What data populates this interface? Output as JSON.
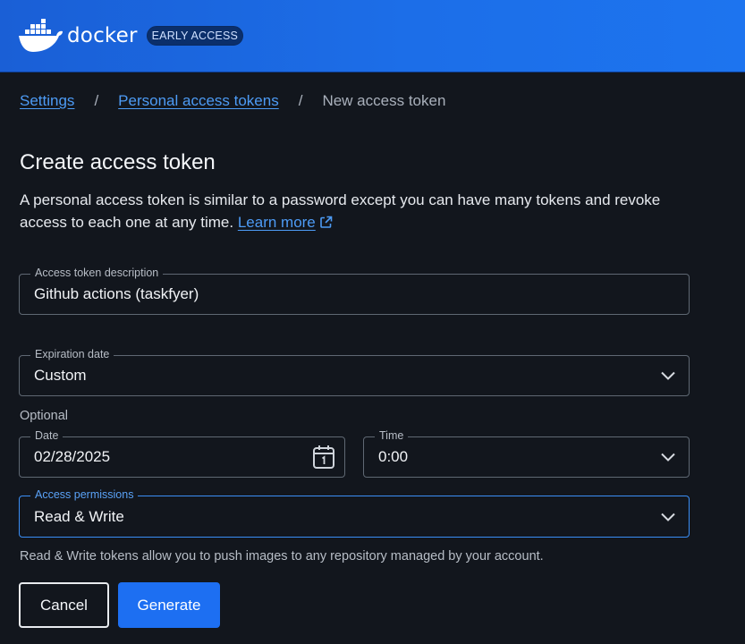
{
  "header": {
    "brand": "docker",
    "badge": "EARLY ACCESS",
    "brand_color": "#1d6ff2"
  },
  "breadcrumb": {
    "items": [
      {
        "label": "Settings",
        "link": true
      },
      {
        "label": "Personal access tokens",
        "link": true
      },
      {
        "label": "New access token",
        "link": false
      }
    ],
    "separator": "/"
  },
  "page": {
    "title": "Create access token",
    "description": "A personal access token is similar to a password except you can have many tokens and revoke access to each one at any time.",
    "learn_more": "Learn more"
  },
  "form": {
    "description_field": {
      "label": "Access token description",
      "value": "Github actions (taskfyer)"
    },
    "expiration_field": {
      "label": "Expiration date",
      "value": "Custom"
    },
    "optional_label": "Optional",
    "date_field": {
      "label": "Date",
      "value": "02/28/2025"
    },
    "time_field": {
      "label": "Time",
      "value": "0:00"
    },
    "permissions_field": {
      "label": "Access permissions",
      "value": "Read & Write"
    },
    "helper_text": "Read & Write tokens allow you to push images to any repository managed by your account."
  },
  "actions": {
    "cancel_label": "Cancel",
    "generate_label": "Generate"
  },
  "icons": {
    "logo": "docker-whale-icon",
    "external_link": "external-link-icon",
    "chevron": "chevron-down-icon",
    "calendar": "calendar-icon"
  }
}
